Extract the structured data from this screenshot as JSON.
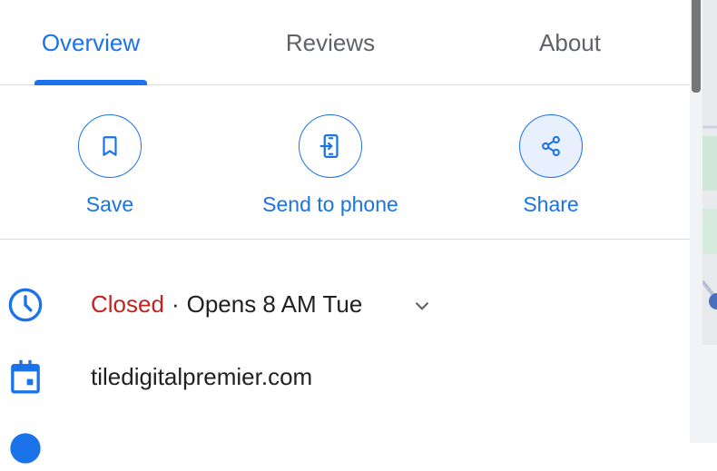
{
  "tabs": [
    {
      "label": "Overview",
      "active": true
    },
    {
      "label": "Reviews",
      "active": false
    },
    {
      "label": "About",
      "active": false
    }
  ],
  "actions": [
    {
      "label": "Save",
      "icon": "bookmark-icon"
    },
    {
      "label": "Send to phone",
      "icon": "send-to-phone-icon"
    },
    {
      "label": "Share",
      "icon": "share-icon"
    }
  ],
  "hours": {
    "status": "Closed",
    "separator": "·",
    "opens": "Opens 8 AM Tue",
    "status_color": "#c5221f"
  },
  "website": {
    "text": "tiledigitalpremier.com"
  },
  "colors": {
    "accent": "#1a73e8",
    "text": "#202124",
    "muted": "#5f6368"
  }
}
